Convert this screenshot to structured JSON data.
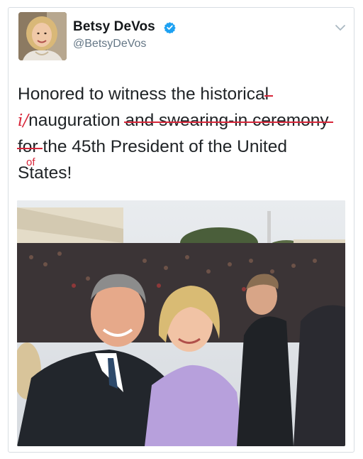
{
  "tweet": {
    "user": {
      "display_name": "Betsy DeVos",
      "handle": "@BetsyDeVos",
      "verified_icon": "verified-badge-icon",
      "avatar_icon": "profile-photo"
    },
    "menu_icon": "chevron-down-icon",
    "text_lines": {
      "line1_a": "Honored to witness the historica",
      "line1_struck": "l",
      "line2_correction": "i/",
      "line2_a": "nauguration ",
      "line2_struck": "and swearing-in ceremony",
      "line3_struck": "for",
      "line3_b": " the 45th President of the United",
      "line3_correction": "of",
      "line4": "States!"
    },
    "photo": {
      "semantic": "inauguration-selfie-photo"
    }
  },
  "colors": {
    "correction_red": "#d8263a",
    "verified_blue": "#1da1f2",
    "handle_gray": "#657786",
    "text_dark": "#1f2326"
  }
}
